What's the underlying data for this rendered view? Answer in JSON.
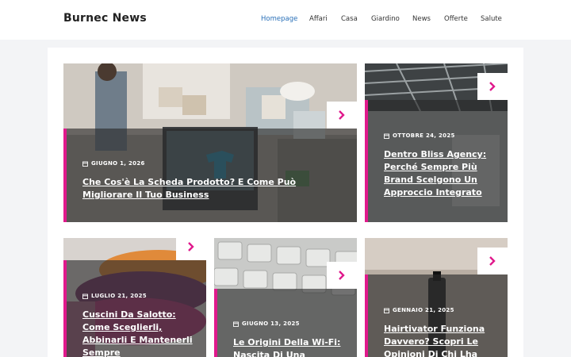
{
  "site": {
    "title": "Burnec News"
  },
  "nav": {
    "items": [
      {
        "label": "Homepage",
        "active": true
      },
      {
        "label": "Affari"
      },
      {
        "label": "Casa"
      },
      {
        "label": "Giardino"
      },
      {
        "label": "News"
      },
      {
        "label": "Offerte"
      },
      {
        "label": "Salute"
      }
    ]
  },
  "colors": {
    "accent": "#e0198c",
    "link_active": "#2a70b8",
    "overlay": "rgba(40,40,40,0.62)"
  },
  "icons": {
    "arrow": "chevron-right-icon",
    "date": "calendar-icon"
  },
  "articles": [
    {
      "date": "GIUGNO 1, 2026",
      "title": "Che Cos'è La Scheda Prodotto? E Come Può Migliorare Il Tuo Business"
    },
    {
      "date": "OTTOBRE 24, 2025",
      "title": "Dentro Bliss Agency: Perché Sempre Più Brand Scelgono Un Approccio Integrato"
    },
    {
      "date": "LUGLIO 21, 2025",
      "title": "Cuscini Da Salotto: Come Sceglierli, Abbinarli E Mantenerli Sempre"
    },
    {
      "date": "GIUGNO 13, 2025",
      "title": "Le Origini Della Wi-Fi: Nascita Di Una"
    },
    {
      "date": "GENNAIO 21, 2025",
      "title": "Hairtivator Funziona Davvero? Scopri Le Opinioni Di Chi Lha"
    }
  ]
}
